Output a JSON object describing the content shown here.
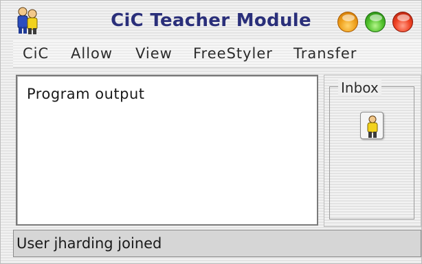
{
  "window": {
    "title": "CiC Teacher Module",
    "app_icon": "two-users-icon",
    "title_color": "#2a2f7a",
    "controls": [
      "minimize-button",
      "zoom-button",
      "close-button"
    ]
  },
  "menubar": {
    "items": [
      "CiC",
      "Allow",
      "View",
      "FreeStyler",
      "Transfer"
    ]
  },
  "output": {
    "text": "Program output"
  },
  "inbox": {
    "title": "Inbox",
    "icon": "user-icon"
  },
  "status": {
    "text": "User jharding joined"
  }
}
